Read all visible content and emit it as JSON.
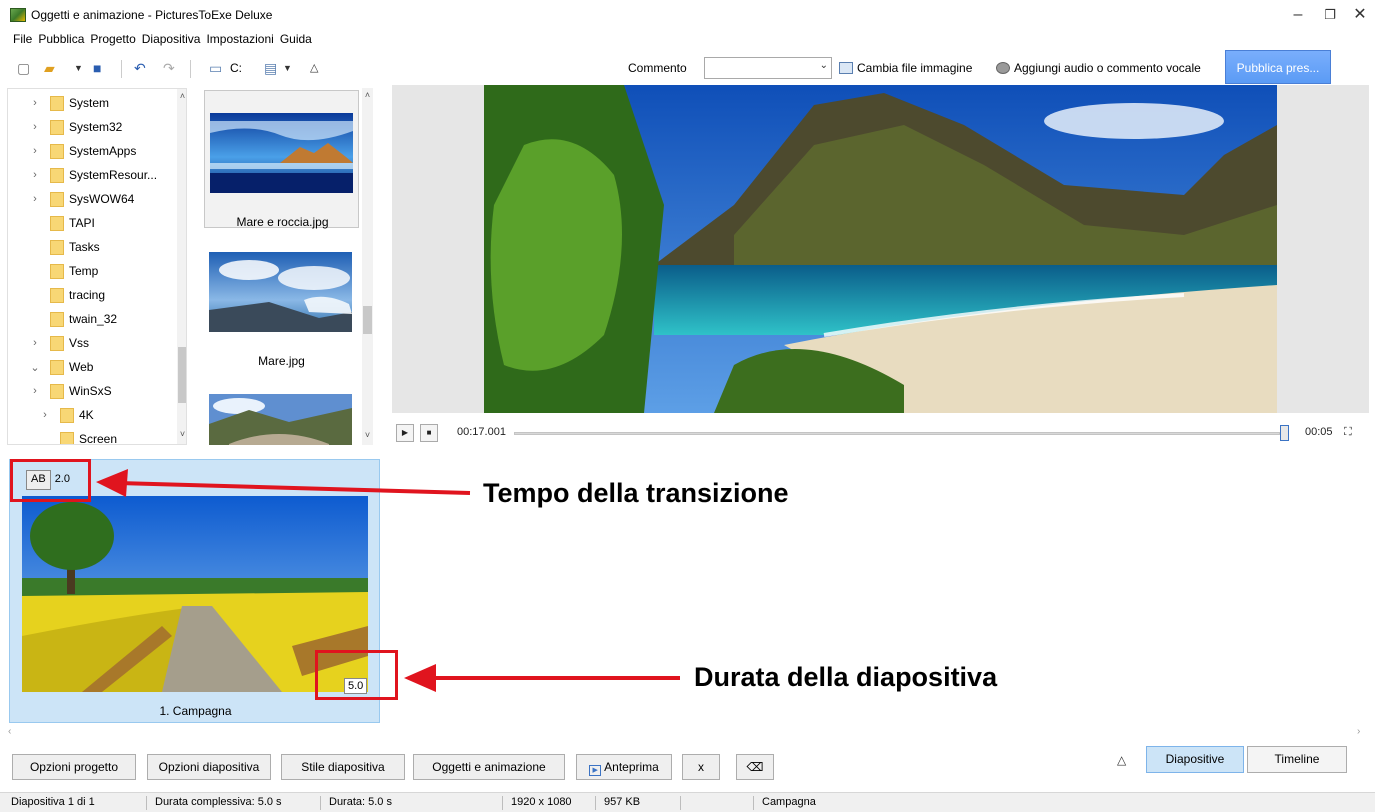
{
  "window": {
    "title": "Oggetti e animazione - PicturesToExe Deluxe"
  },
  "menu": [
    "File",
    "Pubblica",
    "Progetto",
    "Diapositiva",
    "Impostazioni",
    "Guida"
  ],
  "toolbar": {
    "drive_label": "C:",
    "comment_label": "Commento",
    "comment_value": "",
    "change_image_label": "Cambia file immagine",
    "add_audio_label": "Aggiungi audio o commento vocale",
    "publish_label": "Pubblica pres..."
  },
  "folders": [
    {
      "name": "System",
      "expandable": true
    },
    {
      "name": "System32",
      "expandable": true
    },
    {
      "name": "SystemApps",
      "expandable": true
    },
    {
      "name": "SystemResour...",
      "expandable": true
    },
    {
      "name": "SysWOW64",
      "expandable": true
    },
    {
      "name": "TAPI",
      "expandable": false
    },
    {
      "name": "Tasks",
      "expandable": false
    },
    {
      "name": "Temp",
      "expandable": false
    },
    {
      "name": "tracing",
      "expandable": false
    },
    {
      "name": "twain_32",
      "expandable": false
    },
    {
      "name": "Vss",
      "expandable": true
    },
    {
      "name": "Web",
      "expandable": true,
      "expanded": true
    },
    {
      "name": "WinSxS",
      "expandable": true
    },
    {
      "name": "4K",
      "expandable": true
    },
    {
      "name": "Screen",
      "expandable": false
    }
  ],
  "thumbnails": [
    {
      "label": "Mare e roccia.jpg",
      "selected": true
    },
    {
      "label": "Mare.jpg",
      "selected": false
    },
    {
      "label": "",
      "selected": false
    }
  ],
  "playback": {
    "current_time": "00:17.001",
    "total_time": "00:05",
    "position": 1.0
  },
  "slide": {
    "transition_prefix": "AB",
    "transition_time": "2.0",
    "duration": "5.0",
    "label": "1. Campagna"
  },
  "annotations": {
    "transition": "Tempo della transizione",
    "duration": "Durata della diapositiva"
  },
  "buttons": {
    "project_options": "Opzioni progetto",
    "slide_options": "Opzioni diapositiva",
    "slide_style": "Stile diapositiva",
    "objects_animation": "Oggetti e animazione",
    "preview": "Anteprima",
    "x": "x"
  },
  "tabs": {
    "slides": "Diapositive",
    "timeline": "Timeline"
  },
  "status": {
    "slide_index": "Diapositiva 1 di 1",
    "total_duration": "Durata complessiva: 5.0 s",
    "duration": "Durata: 5.0 s",
    "resolution": "1920 x 1080",
    "size": "957 KB",
    "name": "Campagna"
  },
  "colors": {
    "accent": "#4d90fe",
    "selection": "#cce4f7",
    "annotation": "#e0141e"
  }
}
